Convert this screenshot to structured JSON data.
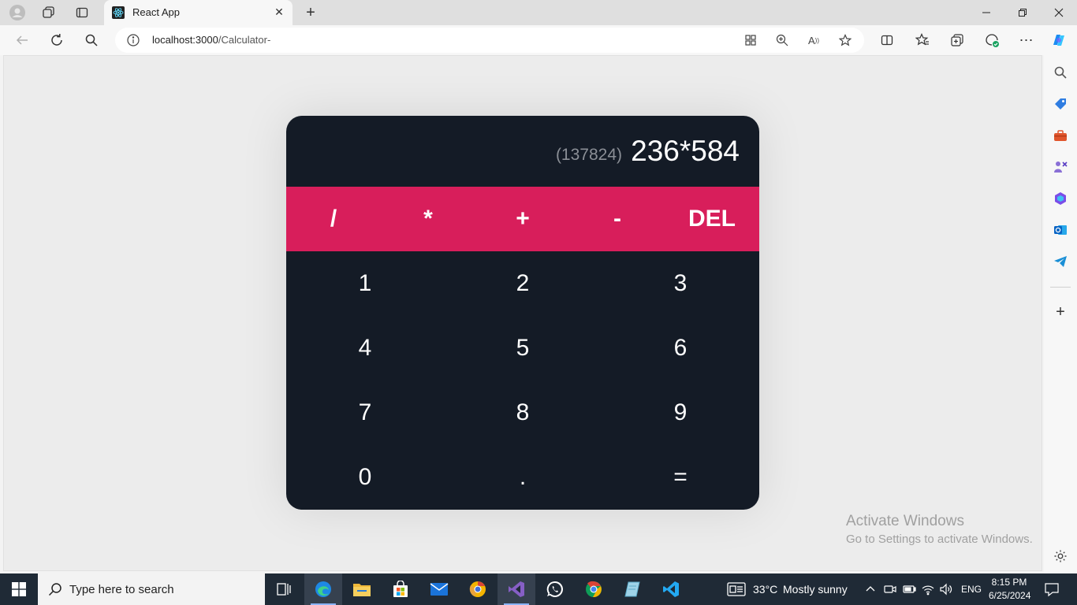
{
  "browser": {
    "tab": {
      "title": "React App",
      "favicon": "react-icon"
    },
    "url": {
      "host": "localhost:3000",
      "path": "/Calculator-"
    },
    "icons": {
      "profile": "profile-icon",
      "workspaces": "workspaces-icon",
      "tab_actions": "tab-actions-icon",
      "back": "back-arrow-icon",
      "refresh": "refresh-icon",
      "search": "search-icon",
      "site_info": "info-icon",
      "app_available": "app-available-icon",
      "zoom": "zoom-icon",
      "read_aloud": "read-aloud-icon",
      "favorite": "star-icon",
      "split_screen": "split-screen-icon",
      "favorites": "favorites-icon",
      "collections": "collections-icon",
      "performance": "performance-icon",
      "more": "more-icon",
      "copilot": "copilot-icon"
    },
    "sidebar_icons": [
      "search-icon",
      "shopping-tag-icon",
      "toolbox-icon",
      "games-icon",
      "office-icon",
      "outlook-icon",
      "telegram-icon",
      "add-icon",
      "settings-icon"
    ]
  },
  "calculator": {
    "result": "(137824)",
    "expression": "236*584",
    "operators": [
      "/",
      "*",
      "+",
      "-",
      "DEL"
    ],
    "digits": [
      "1",
      "2",
      "3",
      "4",
      "5",
      "6",
      "7",
      "8",
      "9",
      "0",
      ".",
      "="
    ],
    "colors": {
      "body": "#141b26",
      "operator_bar": "#d81e5b",
      "result_text": "#8b8f96",
      "text": "#ffffff"
    }
  },
  "watermark": {
    "title": "Activate Windows",
    "subtitle": "Go to Settings to activate Windows."
  },
  "taskbar": {
    "search_placeholder": "Type here to search",
    "apps": [
      "start-icon",
      "task-view-icon",
      "edge-icon",
      "file-explorer-icon",
      "store-icon",
      "mail-icon",
      "chrome-canary-icon",
      "visual-studio-icon",
      "whatsapp-icon",
      "chrome-icon",
      "notepad-icon",
      "vscode-icon"
    ],
    "weather": {
      "temp": "33°C",
      "condition": "Mostly sunny"
    },
    "language": "ENG",
    "time": "8:15 PM",
    "date": "6/25/2024"
  }
}
